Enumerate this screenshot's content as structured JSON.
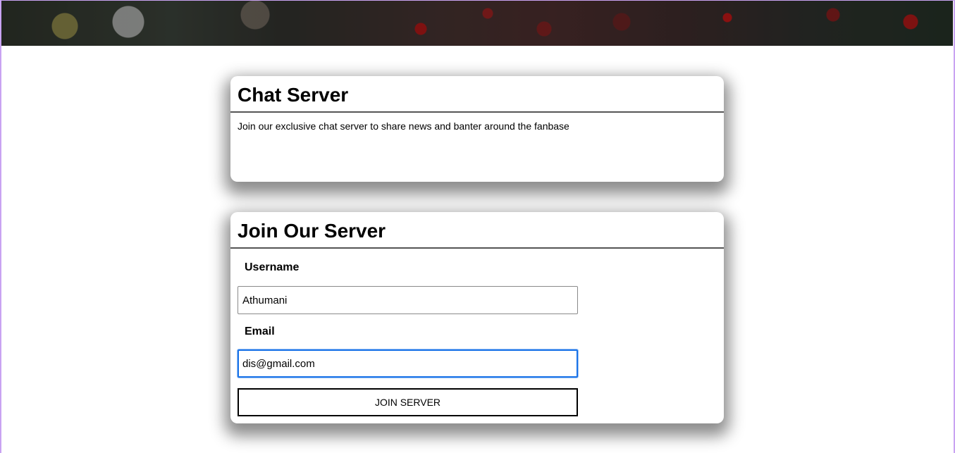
{
  "hero": {
    "image": "stadium-fans-banner"
  },
  "chat_card": {
    "title": "Chat Server",
    "description": "Join our exclusive chat server to share news and banter around the fanbase"
  },
  "join_card": {
    "title": "Join Our Server",
    "username_label": "Username",
    "username_value": "Athumani",
    "email_label": "Email",
    "email_value": "dis@gmail.com",
    "submit_label": "JOIN SERVER"
  },
  "colors": {
    "focus_border": "#1a73e8",
    "frame_border": "#c9a3f2"
  }
}
